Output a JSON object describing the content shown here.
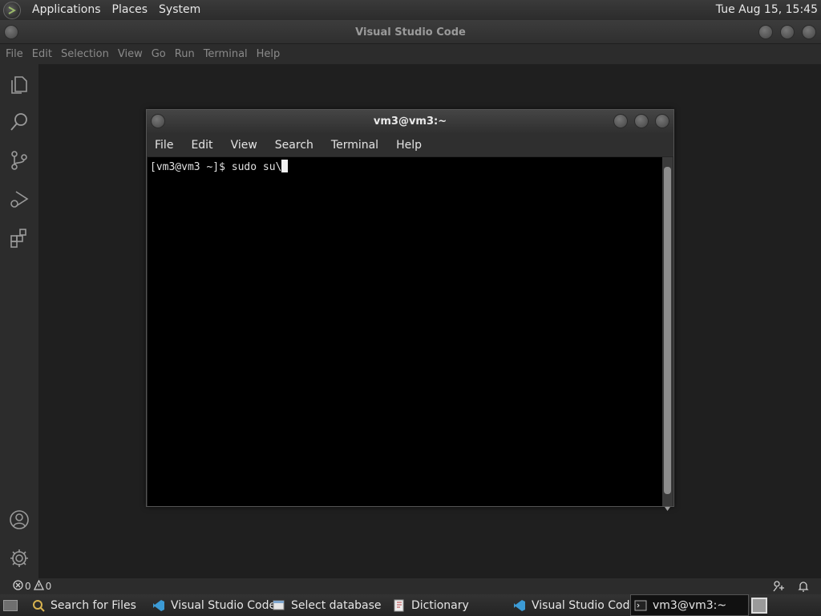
{
  "top_panel": {
    "menu": [
      "Applications",
      "Places",
      "System"
    ],
    "clock": "Tue Aug 15, 15:45"
  },
  "vscode": {
    "title": "Visual Studio Code",
    "menu": [
      "File",
      "Edit",
      "Selection",
      "View",
      "Go",
      "Run",
      "Terminal",
      "Help"
    ],
    "activity_icons": [
      "explorer-icon",
      "search-icon",
      "source-control-icon",
      "run-debug-icon",
      "extensions-icon",
      "accounts-icon",
      "manage-gear-icon"
    ],
    "status": {
      "errors": "0",
      "warnings": "0"
    }
  },
  "terminal": {
    "title": "vm3@vm3:~",
    "menu": [
      "File",
      "Edit",
      "View",
      "Search",
      "Terminal",
      "Help"
    ],
    "line": "[vm3@vm3 ~]$ sudo su\\"
  },
  "taskbar": {
    "items": [
      "Search for Files",
      "Visual Studio Code",
      "Select database",
      "Dictionary",
      "Visual Studio Code",
      "vm3@vm3:~"
    ]
  },
  "colors": {
    "accent": "#3c9bd6",
    "panel": "#2c2c2c",
    "editor_bg": "#1f1f1f",
    "terminal_bg": "#000000"
  }
}
